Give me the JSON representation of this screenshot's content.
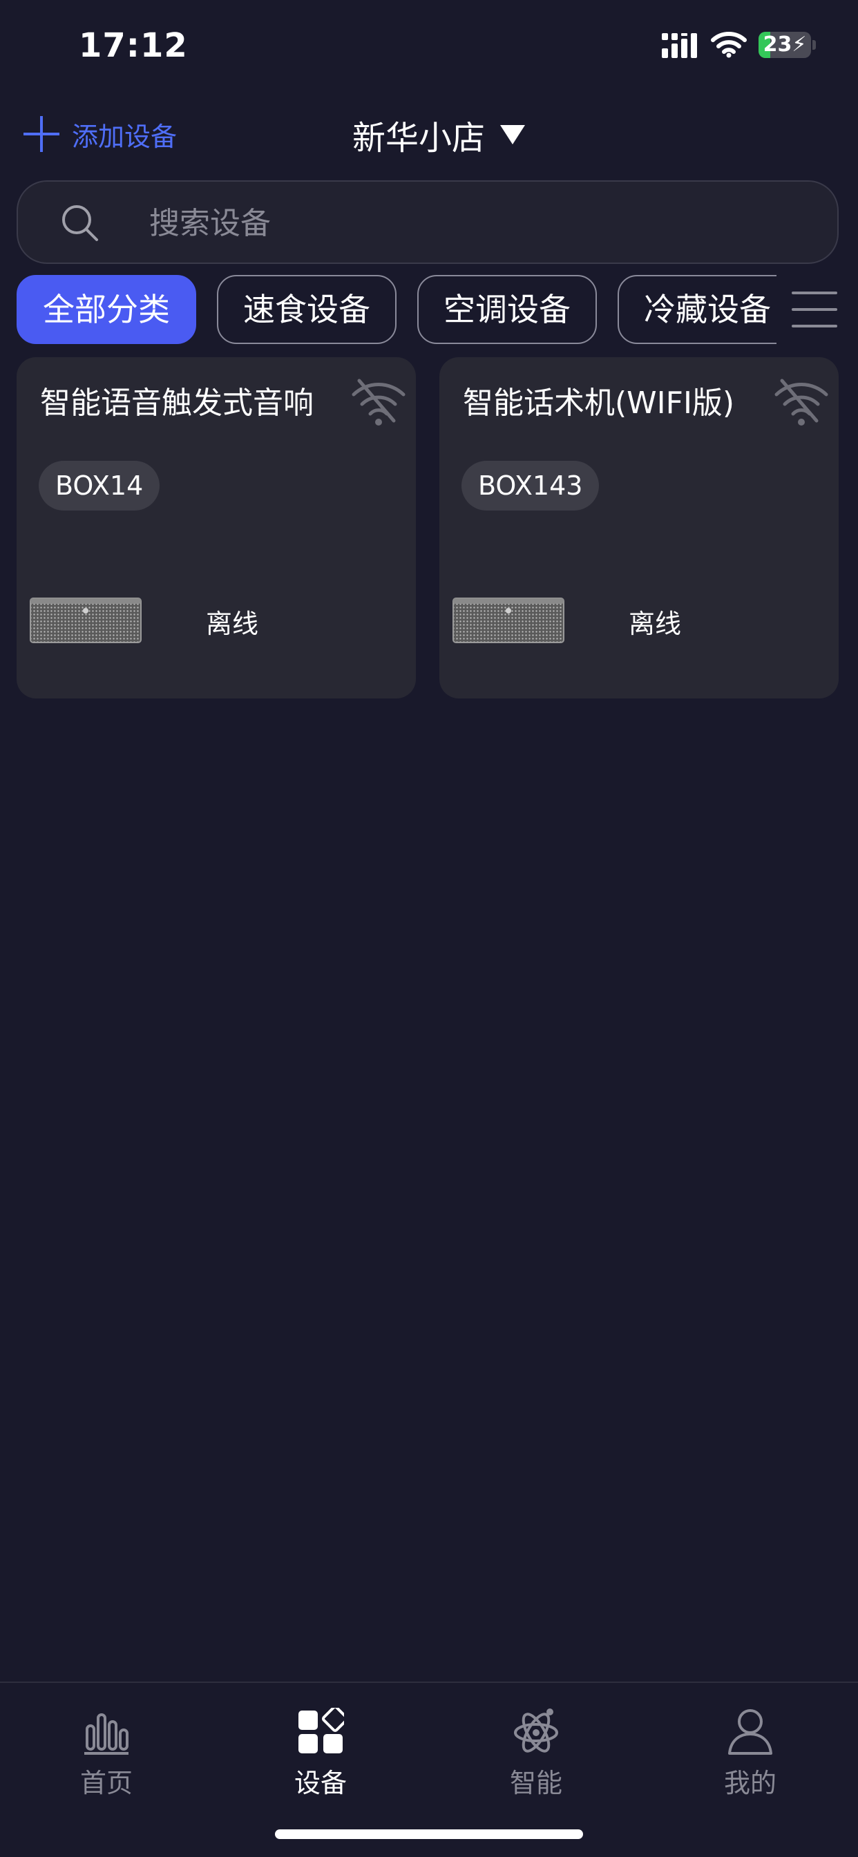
{
  "status_bar": {
    "time": "17:12",
    "battery_level": 23,
    "battery_text": "23",
    "charging": true,
    "battery_color": "#34c759"
  },
  "header": {
    "add_device_label": "添加设备",
    "store_name": "新华小店"
  },
  "search": {
    "placeholder": "搜索设备"
  },
  "tabs": [
    {
      "label": "全部分类",
      "active": true
    },
    {
      "label": "速食设备",
      "active": false
    },
    {
      "label": "空调设备",
      "active": false
    },
    {
      "label": "冷藏设备",
      "active": false
    }
  ],
  "devices": [
    {
      "name": "智能语音触发式音响",
      "code": "BOX14",
      "status": "离线",
      "wifi": "wifi-off-icon"
    },
    {
      "name": "智能话术机(WIFI版)",
      "code": "BOX143",
      "status": "离线",
      "wifi": "wifi-off-icon"
    }
  ],
  "bottom_nav": [
    {
      "label": "首页",
      "icon": "home-chart-icon",
      "active": false
    },
    {
      "label": "设备",
      "icon": "devices-grid-icon",
      "active": true
    },
    {
      "label": "智能",
      "icon": "atom-icon",
      "active": false
    },
    {
      "label": "我的",
      "icon": "user-icon",
      "active": false
    }
  ],
  "colors": {
    "background": "#19192b",
    "accent": "#4a5bf2",
    "link": "#4f6ef7",
    "card": "#282833"
  }
}
